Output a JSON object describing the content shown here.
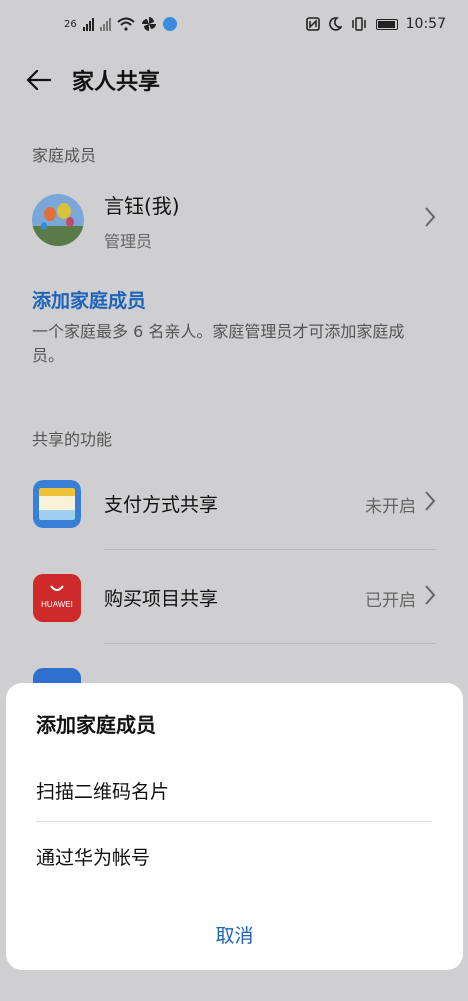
{
  "status_bar": {
    "network_label": "26",
    "time": "10:57"
  },
  "header": {
    "title": "家人共享",
    "back_icon": "arrow-left-icon"
  },
  "family": {
    "section_label": "家庭成员",
    "member": {
      "name": "言钰(我)",
      "role": "管理员"
    },
    "add_member_label": "添加家庭成员",
    "description": "一个家庭最多 6 名亲人。家庭管理员才可添加家庭成员。"
  },
  "features": {
    "section_label": "共享的功能",
    "items": [
      {
        "label": "支付方式共享",
        "status": "未开启",
        "icon": "wallet-icon"
      },
      {
        "label": "购买项目共享",
        "status": "已开启",
        "icon": "huawei-appgallery-icon",
        "icon_text": "HUAWEI"
      }
    ]
  },
  "sheet": {
    "title": "添加家庭成员",
    "options": [
      "扫描二维码名片",
      "通过华为帐号"
    ],
    "cancel": "取消"
  },
  "colors": {
    "accent": "#1d64b8",
    "background": "#cfcfd1",
    "sheet": "#ffffff",
    "huawei_red": "#cf2a2a"
  }
}
